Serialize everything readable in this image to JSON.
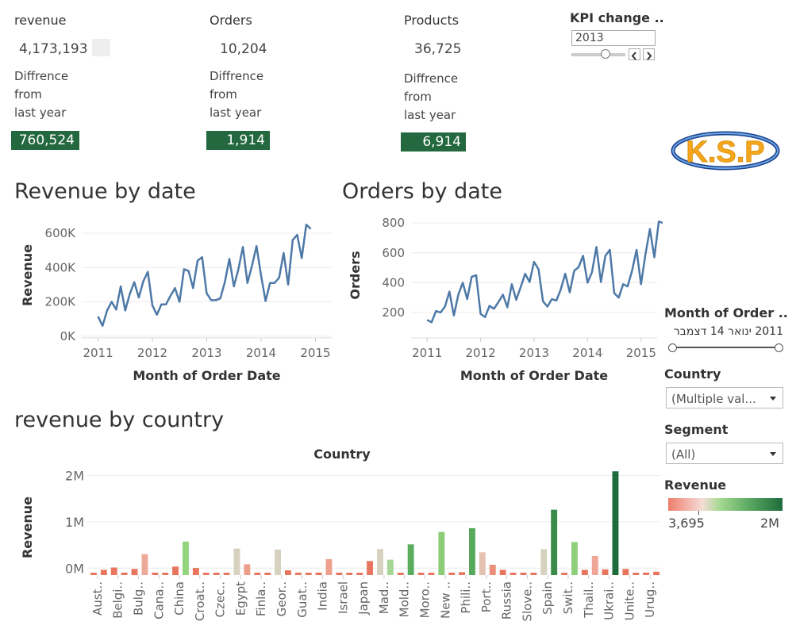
{
  "kpis": [
    {
      "title": "revenue",
      "value": "4,173,193",
      "diff_label": [
        "Diffrence",
        "from",
        "last year"
      ],
      "diff": "760,524"
    },
    {
      "title": "Orders",
      "value": "10,204",
      "diff_label": [
        "Diffrence",
        "from",
        "last year"
      ],
      "diff": "1,914"
    },
    {
      "title": "Products",
      "value": "36,725",
      "diff_label": [
        "Diffrence",
        "from",
        "last year"
      ],
      "diff": "6,914"
    }
  ],
  "kpi_param": {
    "title": "KPI change ..",
    "year": "2013"
  },
  "logo": {
    "text": "K.S.P"
  },
  "sections": {
    "revenue_by_date": "Revenue by date",
    "orders_by_date": "Orders by date",
    "revenue_by_country": "revenue by country"
  },
  "filters": {
    "month_label": "Month of Order ..",
    "month_range": "2011 ינואר 14 דצמבר",
    "country_label": "Country",
    "country_value": "(Multiple val...",
    "segment_label": "Segment",
    "segment_value": "(All)",
    "revenue_label": "Revenue",
    "revenue_min": "3,695",
    "revenue_max": "2M"
  },
  "colors": {
    "line": "#4e79a7",
    "kpi_box": "#23683e",
    "bar_low": "#e8745f",
    "bar_mid": "#d6d2bf",
    "bar_high": "#1e6b3c"
  },
  "chart_data": [
    {
      "type": "line",
      "title": "Revenue by date",
      "xlabel": "Month of Order Date",
      "ylabel": "Revenue",
      "xticks": [
        "2011",
        "2012",
        "2013",
        "2014",
        "2015"
      ],
      "yticks": [
        "0K",
        "200K",
        "400K",
        "600K"
      ],
      "ylim": [
        -10000,
        720000
      ],
      "xlim": [
        2010.7,
        2015.3
      ],
      "x_start": 2011.0,
      "x_step": 0.0833,
      "values": [
        115000,
        60000,
        150000,
        200000,
        155000,
        290000,
        150000,
        245000,
        315000,
        225000,
        320000,
        375000,
        180000,
        125000,
        185000,
        185000,
        235000,
        280000,
        200000,
        390000,
        380000,
        280000,
        440000,
        460000,
        250000,
        210000,
        210000,
        220000,
        315000,
        450000,
        290000,
        390000,
        520000,
        310000,
        410000,
        525000,
        355000,
        205000,
        310000,
        310000,
        340000,
        485000,
        300000,
        560000,
        590000,
        455000,
        650000,
        625000
      ]
    },
    {
      "type": "line",
      "title": "Orders by date",
      "xlabel": "Month of Order Date",
      "ylabel": "Orders",
      "xticks": [
        "2011",
        "2012",
        "2013",
        "2014",
        "2015"
      ],
      "yticks": [
        "200",
        "400",
        "600",
        "800"
      ],
      "ylim": [
        30,
        870
      ],
      "xlim": [
        2010.7,
        2015.3
      ],
      "x_start": 2011.0,
      "x_step": 0.0833,
      "values": [
        150,
        135,
        210,
        200,
        240,
        340,
        180,
        320,
        400,
        290,
        440,
        450,
        190,
        170,
        245,
        225,
        270,
        320,
        235,
        390,
        285,
        370,
        460,
        405,
        540,
        490,
        275,
        240,
        290,
        280,
        355,
        460,
        335,
        480,
        505,
        580,
        400,
        470,
        640,
        405,
        580,
        620,
        330,
        300,
        390,
        375,
        480,
        620,
        390,
        590,
        760,
        570,
        810,
        800
      ]
    },
    {
      "type": "bar",
      "title": "Country",
      "ylabel": "Revenue",
      "yticks": [
        "0M",
        "1M",
        "2M"
      ],
      "ylim": [
        -150000,
        2250000
      ],
      "categories": [
        "Aust..",
        "Belgi..",
        "Bulg..",
        "Cana..",
        "China",
        "Croat..",
        "Czec..",
        "Egypt",
        "Finla..",
        "Geor..",
        "Guat..",
        "India",
        "Israel",
        "Japan",
        "Mad..",
        "Mold..",
        "Moro..",
        "New ..",
        "Phili..",
        "Port..",
        "Russia",
        "Slove..",
        "Spain",
        "Swit..",
        "Thail..",
        "Ukrai..",
        "Unite..",
        "Urug.."
      ],
      "values": [
        [
          30000,
          150000,
          120000,
          40000,
          170000,
          140000,
          20000,
          560000,
          -20000,
          540000,
          40000,
          40000,
          40000,
          30000,
          550000,
          -20000,
          -20000,
          920000,
          50000,
          480000,
          100000,
          40000,
          550000,
          20000,
          100000,
          110000,
          120000,
          40000
        ],
        [
          100000,
          40000,
          440000,
          30000,
          710000,
          20000,
          30000,
          220000,
          -20000,
          90000,
          30000,
          330000,
          20000,
          290000,
          320000,
          650000,
          20000,
          40000,
          1000000,
          210000,
          20000,
          -20000,
          1400000,
          700000,
          400000,
          2230000,
          -20000,
          60000
        ]
      ],
      "bar_colors": [
        [
          "#e8765f",
          "#e8765f",
          "#e8765f",
          "#e8765f",
          "#e8765f",
          "#e8765f",
          "#e8765f",
          "#d6d2bf",
          "#e8765f",
          "#d6d2bf",
          "#e8765f",
          "#e8765f",
          "#e8765f",
          "#e8765f",
          "#d6d2bf",
          "#e8765f",
          "#e8765f",
          "#8ccc78",
          "#e8765f",
          "#e3c2b2",
          "#e8765f",
          "#e8765f",
          "#d6d2bf",
          "#e8765f",
          "#e8765f",
          "#e8765f",
          "#e8765f",
          "#e8765f"
        ],
        [
          "#e8765f",
          "#e8765f",
          "#eeaa98",
          "#e8765f",
          "#93d47f",
          "#e8765f",
          "#e8765f",
          "#ec9e8b",
          "#e8765f",
          "#e8765f",
          "#e8765f",
          "#eca08d",
          "#e8765f",
          "#e8765f",
          "#a7d595",
          "#5aad5d",
          "#e8765f",
          "#e8765f",
          "#56a95b",
          "#ec8f7a",
          "#e8765f",
          "#e8765f",
          "#3a8c4a",
          "#8fd07d",
          "#efa696",
          "#1e6b3c",
          "#e8765f",
          "#e8765f"
        ]
      ]
    }
  ]
}
